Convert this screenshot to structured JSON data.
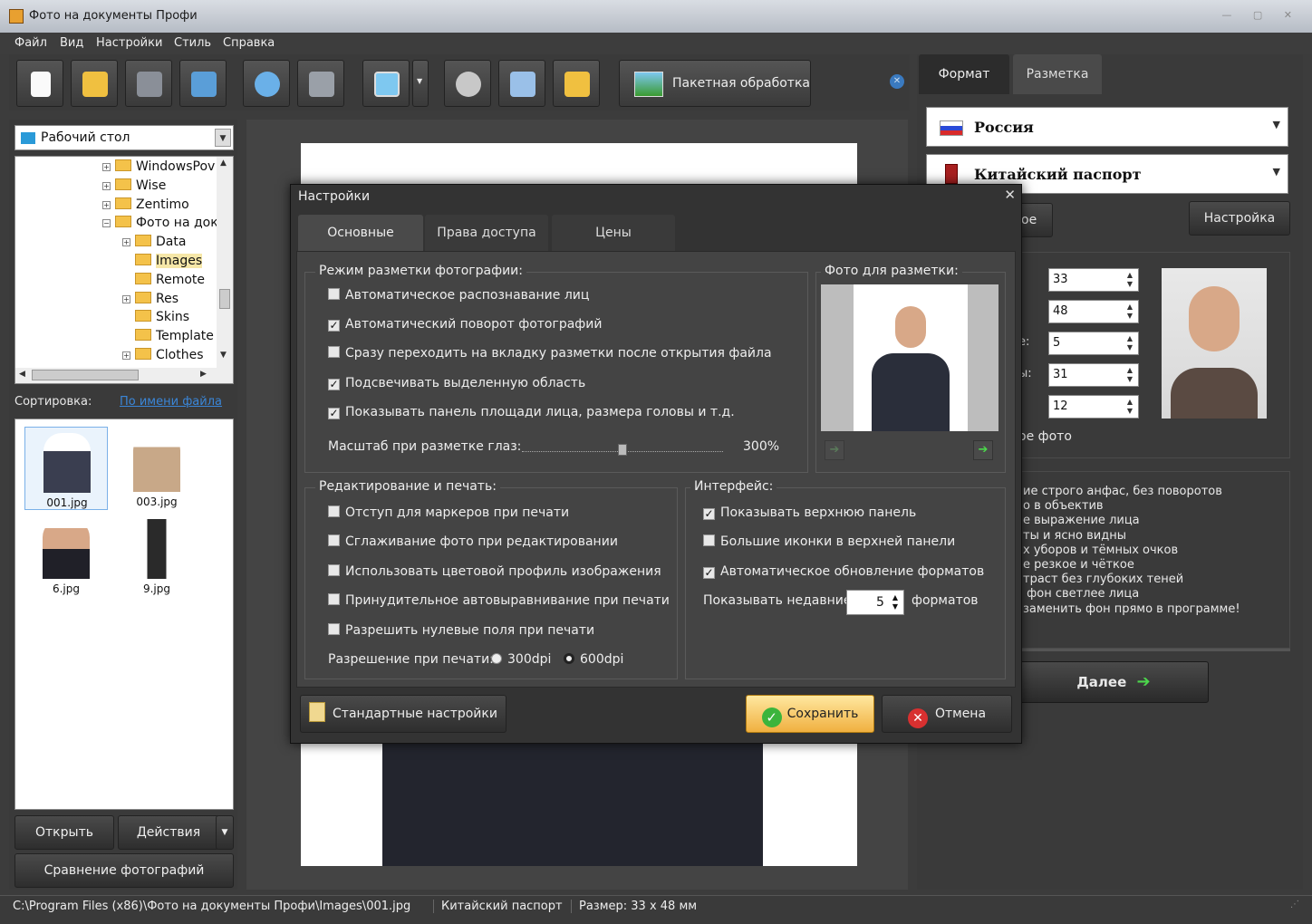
{
  "window": {
    "title": "Фото на документы Профи"
  },
  "menu": [
    "Файл",
    "Вид",
    "Настройки",
    "Стиль",
    "Справка"
  ],
  "toolbar": {
    "batch_label": "Пакетная обработка"
  },
  "left": {
    "folder_combo": "Рабочий стол",
    "tree": [
      {
        "label": "WindowsPov",
        "plus": true,
        "indent": 0
      },
      {
        "label": "Wise",
        "plus": true,
        "indent": 0
      },
      {
        "label": "Zentimo",
        "plus": true,
        "indent": 0
      },
      {
        "label": "Фото на док",
        "plus": true,
        "indent": 0,
        "minus": true
      },
      {
        "label": "Data",
        "plus": true,
        "indent": 1
      },
      {
        "label": "Images",
        "plus": false,
        "indent": 1,
        "selected": true
      },
      {
        "label": "Remote",
        "plus": false,
        "indent": 1
      },
      {
        "label": "Res",
        "plus": true,
        "indent": 1
      },
      {
        "label": "Skins",
        "plus": false,
        "indent": 1
      },
      {
        "label": "Template",
        "plus": false,
        "indent": 1
      },
      {
        "label": "Clothes",
        "plus": true,
        "indent": 1
      }
    ],
    "sort_label": "Сортировка:",
    "sort_link": "По имени файла",
    "thumbs": [
      "001.jpg",
      "003.jpg",
      "6.jpg",
      "9.jpg"
    ],
    "open_btn": "Открыть",
    "actions_btn": "Действия",
    "compare_btn": "Сравнение фотографий"
  },
  "right": {
    "tabs": [
      "Формат",
      "Разметка"
    ],
    "country": "Россия",
    "document": "Китайский паспорт",
    "partial_btn": "ое",
    "settings_btn": "Настройка",
    "spins": [
      "33",
      "48",
      "5",
      "31",
      "12"
    ],
    "spin_labels": [
      "е:",
      "ы:",
      ":"
    ],
    "photo_label": "ое фото",
    "requirements": [
      "ие строго анфас, без поворотов",
      "о в объектив",
      "е выражение лица",
      "ты и ясно видны",
      "х уборов и тёмных очков",
      "е резкое и чёткое",
      "траст без глубоких теней",
      " фон светлее лица",
      "заменить фон прямо в программе!"
    ],
    "next_btn": "Далее"
  },
  "dialog": {
    "title": "Настройки",
    "tabs": [
      "Основные",
      "Права доступа",
      "Цены"
    ],
    "markup_group": "Режим разметки фотографии:",
    "markup_opts": [
      {
        "label": "Автоматическое распознавание лиц",
        "checked": false
      },
      {
        "label": "Автоматический поворот фотографий",
        "checked": true
      },
      {
        "label": "Сразу переходить на вкладку разметки после открытия файла",
        "checked": false
      },
      {
        "label": "Подсвечивать выделенную область",
        "checked": true
      },
      {
        "label": "Показывать панель площади лица, размера головы и т.д.",
        "checked": true
      }
    ],
    "eye_scale_label": "Масштаб при разметке глаз:",
    "eye_scale_value": "300%",
    "eye_scale_fraction": 0.5,
    "photo_group": "Фото для разметки:",
    "edit_group": "Редактирование и печать:",
    "edit_opts": [
      {
        "label": "Отступ для маркеров при печати",
        "checked": false
      },
      {
        "label": "Сглаживание фото при редактировании",
        "checked": false
      },
      {
        "label": "Использовать цветовой профиль изображения",
        "checked": false
      },
      {
        "label": "Принудительное автовыравнивание при печати",
        "checked": false
      },
      {
        "label": "Разрешить нулевые поля при печати",
        "checked": false
      }
    ],
    "resolution_label": "Разрешение при печати:",
    "res_300": "300dpi",
    "res_600": "600dpi",
    "iface_group": "Интерфейс:",
    "iface_opts": [
      {
        "label": "Показывать верхнюю панель",
        "checked": true
      },
      {
        "label": "Большие иконки в верхней панели",
        "checked": false
      },
      {
        "label": "Автоматическое обновление форматов",
        "checked": true
      }
    ],
    "recent_label": "Показывать недавние",
    "recent_value": "5",
    "recent_suffix": "форматов",
    "defaults_btn": "Стандартные настройки",
    "save_btn": "Сохранить",
    "cancel_btn": "Отмена"
  },
  "status": {
    "path": "C:\\Program Files (x86)\\Фото на документы Профи\\Images\\001.jpg",
    "doc": "Китайский паспорт",
    "size": "Размер: 33 x 48 мм"
  }
}
